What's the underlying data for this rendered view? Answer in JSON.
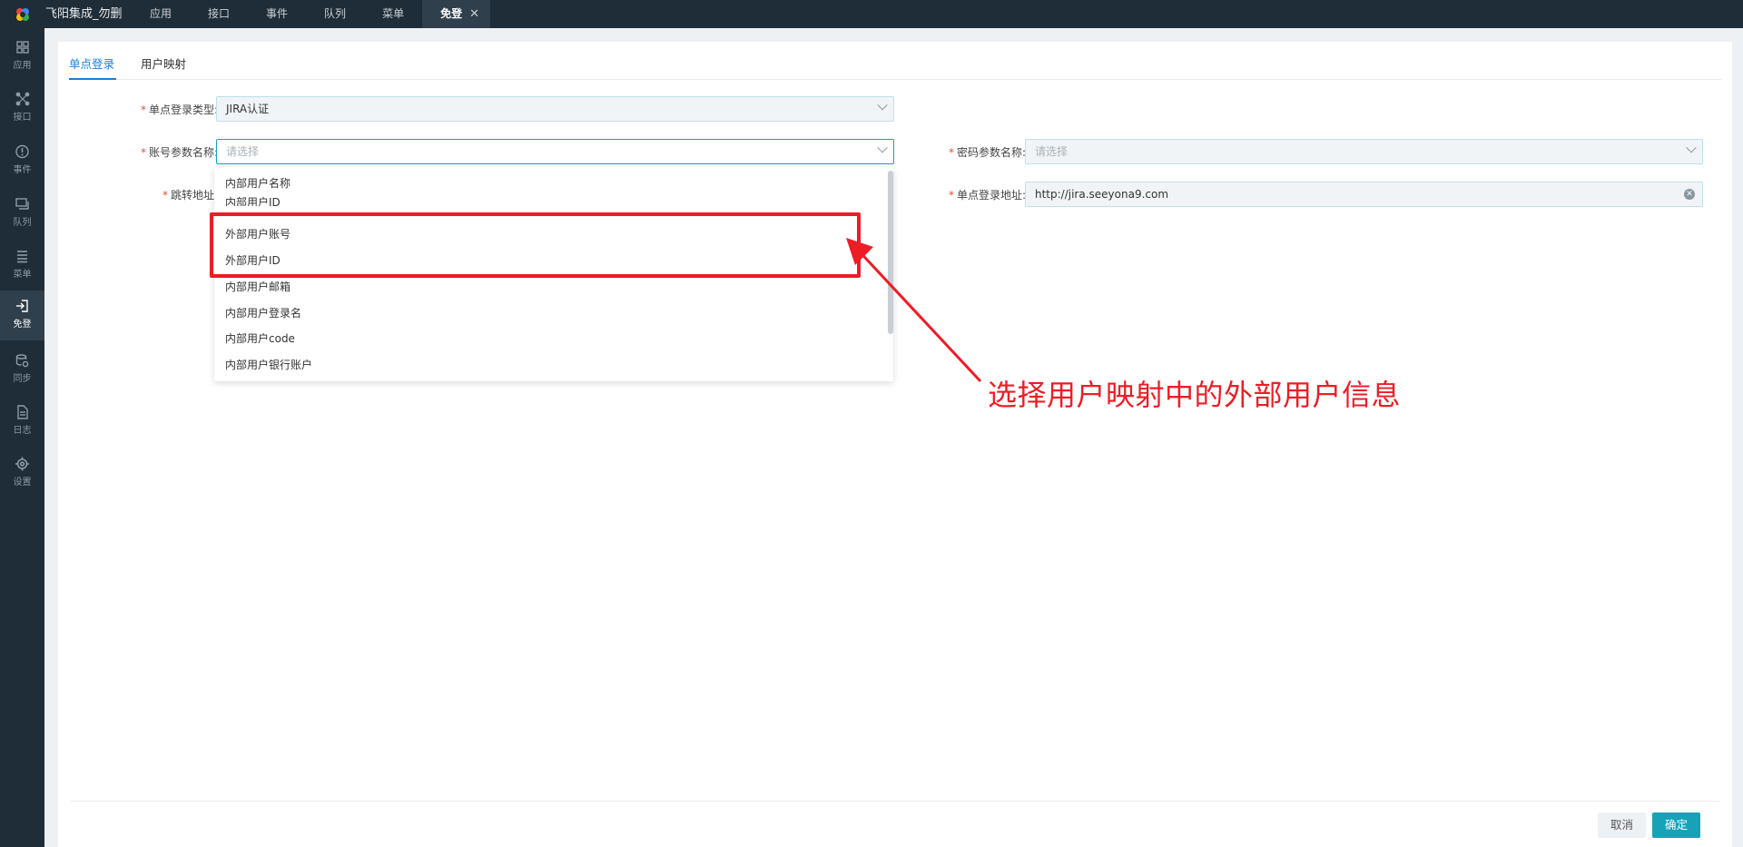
{
  "window": {
    "app_title": "飞阳集成_勿删"
  },
  "top_tabs": [
    {
      "label": "应用"
    },
    {
      "label": "接口"
    },
    {
      "label": "事件"
    },
    {
      "label": "队列"
    },
    {
      "label": "菜单"
    },
    {
      "label": "免登",
      "active": true,
      "close": "✕"
    }
  ],
  "sidebar": {
    "items": [
      {
        "label": "应用",
        "icon": "grid-icon"
      },
      {
        "label": "接口",
        "icon": "network-icon"
      },
      {
        "label": "事件",
        "icon": "alert-icon"
      },
      {
        "label": "队列",
        "icon": "queue-icon"
      },
      {
        "label": "菜单",
        "icon": "menu-icon"
      },
      {
        "label": "免登",
        "icon": "login-icon",
        "active": true
      },
      {
        "label": "同步",
        "icon": "sync-icon"
      },
      {
        "label": "日志",
        "icon": "document-icon"
      },
      {
        "label": "设置",
        "icon": "gear-icon"
      }
    ]
  },
  "sub_tabs": [
    {
      "label": "单点登录",
      "active": true
    },
    {
      "label": "用户映射"
    }
  ],
  "form": {
    "required_mark": "*",
    "sso_type": {
      "label": "单点登录类型:",
      "value": "JIRA认证"
    },
    "account_param": {
      "label": "账号参数名称:",
      "placeholder": "请选择"
    },
    "password_param": {
      "label": "密码参数名称:",
      "placeholder": "请选择"
    },
    "redirect_url": {
      "label": "跳转地址:"
    },
    "sso_url": {
      "label": "单点登录地址:",
      "value": "http://jira.seeyona9.com"
    }
  },
  "dropdown": {
    "options": [
      "内部用户名称",
      "内部用户ID",
      "外部用户账号",
      "外部用户ID",
      "内部用户邮箱",
      "内部用户登录名",
      "内部用户code",
      "内部用户银行账户"
    ]
  },
  "annotation": {
    "text": "选择用户映射中的外部用户信息",
    "color": "#ee1c25"
  },
  "footer": {
    "cancel_label": "取消",
    "ok_label": "确定"
  },
  "colors": {
    "accent": "#17a2b8",
    "tab_active": "#1c7ed6",
    "sidebar_bg": "#1f2d38"
  }
}
